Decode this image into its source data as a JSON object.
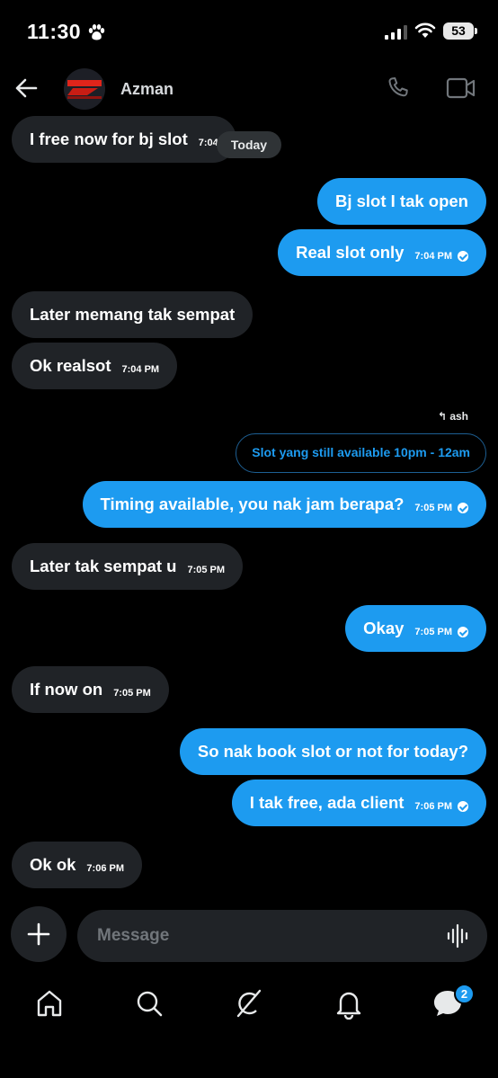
{
  "status_bar": {
    "time": "11:30",
    "battery": "53"
  },
  "header": {
    "contact_name": "Azman"
  },
  "date_separator": "Today",
  "messages": [
    {
      "text": "I free now for bj slot",
      "time": "7:04"
    },
    {
      "text": "Bj slot I tak open"
    },
    {
      "text": "Real slot only",
      "time": "7:04 PM"
    },
    {
      "text": "Later memang tak sempat"
    },
    {
      "text": "Ok realsot",
      "time": "7:04 PM"
    },
    {
      "text": "Timing available, you nak jam berapa?",
      "time": "7:05 PM"
    },
    {
      "text": "Later tak sempat u",
      "time": "7:05 PM"
    },
    {
      "text": "Okay",
      "time": "7:05 PM"
    },
    {
      "text": "If now on",
      "time": "7:05 PM"
    },
    {
      "text": "So nak book slot or not for today?"
    },
    {
      "text": "I tak free, ada client",
      "time": "7:06 PM"
    },
    {
      "text": "Ok ok",
      "time": "7:06 PM"
    }
  ],
  "reply": {
    "label": "ash",
    "quoted_text": "Slot yang still available 10pm - 12am"
  },
  "composer": {
    "placeholder": "Message"
  },
  "nav": {
    "messages_badge": "2"
  },
  "colors": {
    "accent": "#1d9bf0",
    "incoming_bubble": "#202327",
    "background": "#000000"
  }
}
